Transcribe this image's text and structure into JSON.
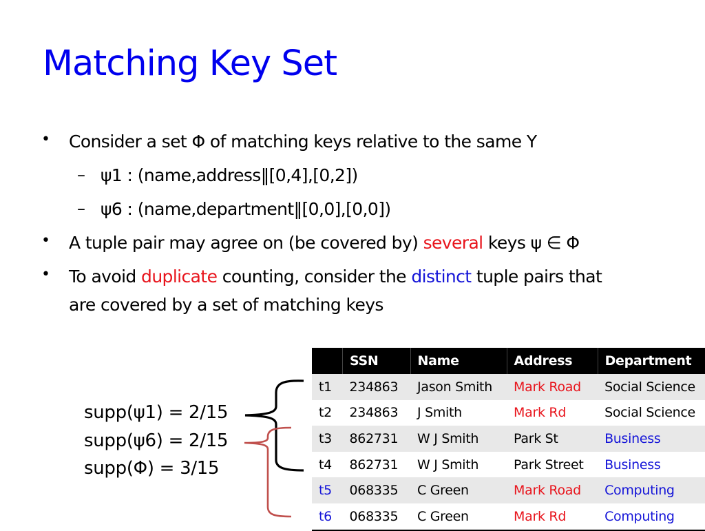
{
  "title": "Matching Key Set",
  "bullets": {
    "b1": {
      "text": "Consider a set Φ of matching keys relative to the same Y",
      "sub": [
        "ψ1 : (name,address‖[0,4],[0,2])",
        "ψ6 : (name,department‖[0,0],[0,0])"
      ]
    },
    "b2": {
      "before": "A tuple pair may agree on (be covered by) ",
      "highlight": "several",
      "after": " keys ψ ∈ Φ"
    },
    "b3": {
      "before": "To avoid ",
      "highlight1": "duplicate",
      "middle": " counting, consider the ",
      "highlight2": "distinct",
      "after": " tuple pairs that",
      "line2": "are covered by a set of matching keys"
    },
    "bullet_glyph": "•",
    "dash_glyph": "–"
  },
  "support": [
    "supp(ψ1) = 2/15",
    "supp(ψ6) = 2/15",
    "supp(Φ) = 3/15"
  ],
  "table": {
    "headers": [
      "",
      "SSN",
      "Name",
      "Address",
      "Department"
    ],
    "rows": [
      {
        "id": "t1",
        "ssn": "234863",
        "name": "Jason Smith",
        "address": "Mark Road",
        "department": "Social Science",
        "id_color": "black",
        "address_color": "red",
        "department_color": "black"
      },
      {
        "id": "t2",
        "ssn": "234863",
        "name": "J Smith",
        "address": "Mark Rd",
        "department": "Social Science",
        "id_color": "black",
        "address_color": "red",
        "department_color": "black"
      },
      {
        "id": "t3",
        "ssn": "862731",
        "name": "W J Smith",
        "address": "Park St",
        "department": "Business",
        "id_color": "black",
        "address_color": "black",
        "department_color": "blue"
      },
      {
        "id": "t4",
        "ssn": "862731",
        "name": "W J Smith",
        "address": "Park Street",
        "department": "Business",
        "id_color": "black",
        "address_color": "black",
        "department_color": "blue"
      },
      {
        "id": "t5",
        "ssn": "068335",
        "name": "C Green",
        "address": "Mark Road",
        "department": "Computing",
        "id_color": "blue",
        "address_color": "red",
        "department_color": "blue"
      },
      {
        "id": "t6",
        "ssn": "068335",
        "name": "C Green",
        "address": "Mark Rd",
        "department": "Computing",
        "id_color": "blue",
        "address_color": "red",
        "department_color": "blue"
      }
    ]
  },
  "colors": {
    "title": "#0000ee",
    "red": "#e8141c",
    "blue": "#1515d8",
    "brace_black": "#000000",
    "brace_red": "#c0504d"
  }
}
